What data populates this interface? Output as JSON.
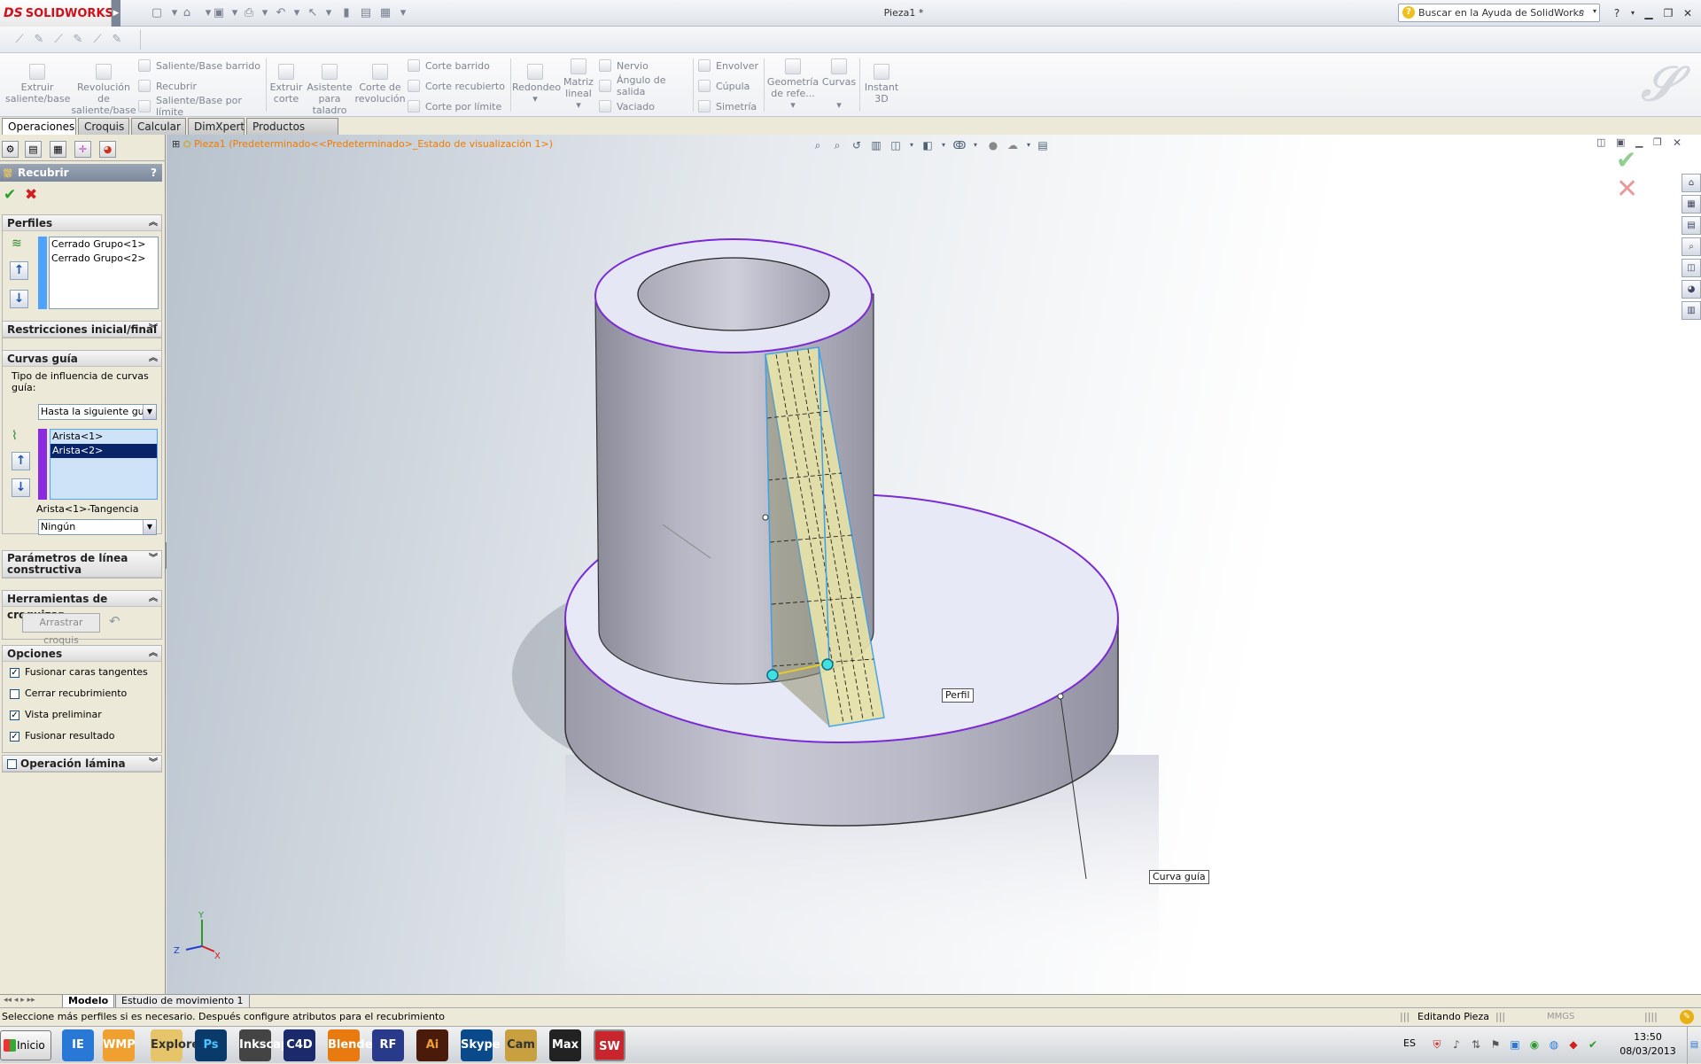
{
  "app": {
    "logo_prefix": "DS",
    "logo_name": "SOLIDWORKS",
    "document_title": "Pieza1 *",
    "search_placeholder": "Buscar en la Ayuda de SolidWorks",
    "help_icon": "?"
  },
  "ribbon": {
    "large_buttons": [
      {
        "id": "extrude-boss",
        "label_1": "Extruir",
        "label_2": "saliente/base",
        "label_3": "",
        "label_4": ""
      },
      {
        "id": "revolve-boss",
        "label_1": "Revolución",
        "label_2": "de",
        "label_3": "saliente/base",
        "label_4": ""
      },
      {
        "id": "extrude-cut",
        "label_1": "Extruir",
        "label_2": "corte",
        "label_3": "",
        "label_4": ""
      },
      {
        "id": "hole-wizard",
        "label_1": "Asistente",
        "label_2": "para",
        "label_3": "taladro",
        "label_4": ""
      },
      {
        "id": "revolve-cut",
        "label_1": "Corte de",
        "label_2": "revolución",
        "label_3": "",
        "label_4": ""
      },
      {
        "id": "fillet",
        "label_1": "Redondeo",
        "label_2": "",
        "label_3": "",
        "label_4": ""
      },
      {
        "id": "linear-pattern",
        "label_1": "Matriz",
        "label_2": "lineal",
        "label_3": "",
        "label_4": ""
      },
      {
        "id": "ref-geometry",
        "label_1": "Geometría",
        "label_2": "de refe...",
        "label_3": "",
        "label_4": ""
      },
      {
        "id": "curves",
        "label_1": "Curvas",
        "label_2": "",
        "label_3": "",
        "label_4": ""
      },
      {
        "id": "instant3d",
        "label_1": "Instant",
        "label_2": "3D",
        "label_3": "",
        "label_4": ""
      }
    ],
    "small_col1": [
      "Saliente/Base barrido",
      "Recubrir",
      "Saliente/Base por límite"
    ],
    "small_col2": [
      "Corte barrido",
      "Corte recubierto",
      "Corte por límite"
    ],
    "small_col3": [
      "Nervio",
      "Ángulo de salida",
      "Vaciado"
    ],
    "small_col4": [
      "Envolver",
      "Cúpula",
      "Simetría"
    ]
  },
  "command_tabs": [
    "Operaciones",
    "Croquis",
    "Calcular",
    "DimXpert",
    "Productos Office"
  ],
  "feature_tree": {
    "root": "Pieza1",
    "config": "(Predeterminado<<Predeterminado>_Estado de visualización 1>)"
  },
  "property_manager": {
    "title": "Recubrir",
    "help": "?",
    "ok": "✔",
    "cancel": "✖",
    "perfiles": {
      "header": "Perfiles",
      "items": [
        "Cerrado Grupo<1>",
        "Cerrado Grupo<2>"
      ]
    },
    "restricciones": {
      "header": "Restricciones inicial/final"
    },
    "curvas_guia": {
      "header": "Curvas guía",
      "influence_label": "Tipo de influencia de curvas guía:",
      "influence_value": "Hasta la siguiente guía",
      "items": [
        "Arista<1>",
        "Arista<2>"
      ],
      "selected_index": 1,
      "tangency_label": "Arista<1>-Tangencia",
      "tangency_value": "Ningún"
    },
    "parametros": {
      "header_1": "Parámetros de línea",
      "header_2": "constructiva"
    },
    "herramientas": {
      "header": "Herramientas de croquizar",
      "drag_button": "Arrastrar croquis"
    },
    "opciones": {
      "header": "Opciones",
      "items": [
        {
          "label": "Fusionar caras tangentes",
          "checked": true
        },
        {
          "label": "Cerrar recubrimiento",
          "checked": false
        },
        {
          "label": "Vista preliminar",
          "checked": true
        },
        {
          "label": "Fusionar resultado",
          "checked": true
        }
      ]
    },
    "lamina": {
      "header": "Operación lámina",
      "checked": false
    }
  },
  "viewport": {
    "callout_profile": "Perfil",
    "callout_guide": "Curva guía",
    "triad": {
      "x": "X",
      "y": "Y",
      "z": "Z"
    }
  },
  "bottom_tabs": [
    "Modelo",
    "Estudio de movimiento 1"
  ],
  "status": {
    "message": "Seleccione más perfiles si es necesario. Después configure atributos para el recubrimiento",
    "mode": "Editando Pieza",
    "units": "MMGS"
  },
  "taskbar": {
    "start": "Inicio",
    "apps": [
      "IE",
      "WMP",
      "Explorer",
      "Ps",
      "Inkscape",
      "C4D",
      "Blender",
      "RF",
      "Ai",
      "Skype",
      "Cam",
      "Max",
      "SW"
    ],
    "language": "ES",
    "time": "13:50",
    "date": "08/03/2013"
  },
  "colors": {
    "accent_orange": "#f07b00",
    "selection_blue": "#0a246a",
    "edge_purple": "#8a2be2",
    "preview_yellow": "#e6e2a8"
  }
}
